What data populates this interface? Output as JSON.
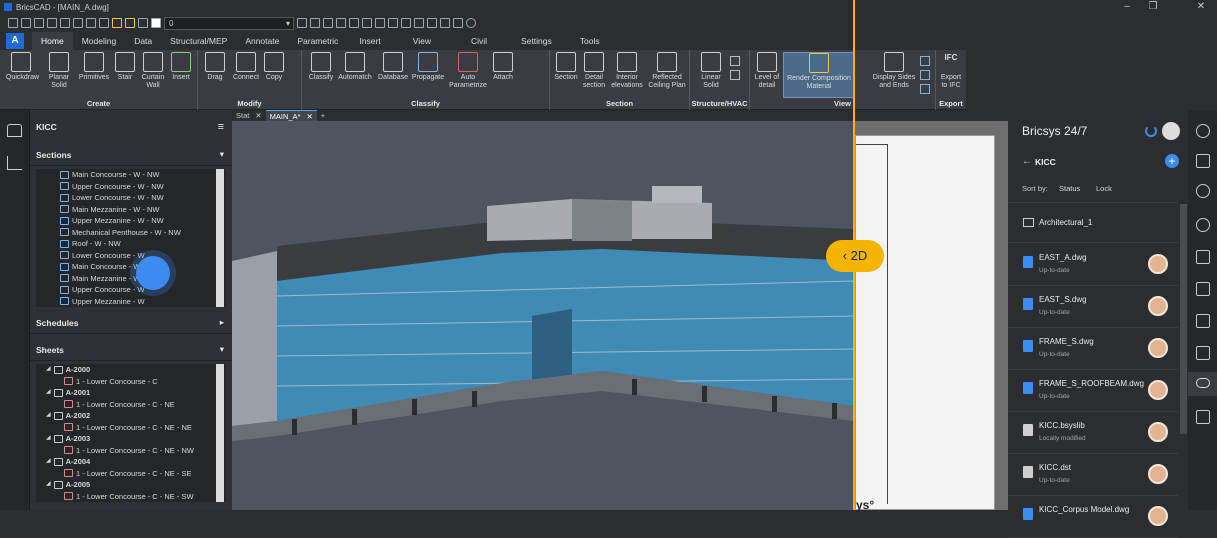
{
  "window": {
    "title": "BricsCAD - [MAIN_A.dwg]",
    "minimize": "–",
    "maximize": "❐",
    "close": "✕"
  },
  "qat": {
    "layer_value": "0"
  },
  "app_button": "A",
  "tabs": [
    "Home",
    "Modeling",
    "Data",
    "Structural/MEP",
    "Annotate",
    "Parametric",
    "Insert",
    "View",
    "Civil",
    "Settings",
    "Tools"
  ],
  "ribbon": {
    "groups": [
      {
        "title": "Create",
        "buttons": [
          "Quickdraw",
          "Planar\nSolid",
          "Primitives",
          "Stair",
          "Curtain\nWall",
          "Insert"
        ]
      },
      {
        "title": "Modify",
        "buttons": [
          "Drag",
          "Connect",
          "Copy"
        ]
      },
      {
        "title": "Classify",
        "buttons": [
          "Classify",
          "Automatch",
          "Database",
          "Propagate",
          "Auto\nParametrize",
          "Attach"
        ]
      },
      {
        "title": "Section",
        "buttons": [
          "Section",
          "Detail\nsection",
          "Interior\nelevations",
          "Reflected\nCeiling Plan"
        ]
      },
      {
        "title": "Structure/HVAC",
        "buttons": [
          "Linear\nSolid"
        ]
      },
      {
        "title": "View",
        "buttons": [
          "Level of\ndetail",
          "Render Composition\nMaterial",
          "Display Sides\nand Ends"
        ]
      },
      {
        "title": "Export",
        "buttons": [
          "Export\nto IFC"
        ]
      }
    ],
    "ifc_label": "IFC"
  },
  "doc_tabs": [
    {
      "label": "Stat",
      "close": "✕"
    },
    {
      "label": "MAIN_A*",
      "close": "✕"
    },
    {
      "label": "+",
      "close": ""
    }
  ],
  "left_panel": {
    "project": "KICC",
    "sections_title": "Sections",
    "sections": [
      "Main Concourse - W - NW",
      "Upper Concourse - W - NW",
      "Lower Concourse - W - NW",
      "Main Mezzanine - W - NW",
      "Upper Mezzanine - W - NW",
      "Mechanical Penthouse - W - NW",
      "Roof - W - NW",
      "Lower Concourse - W",
      "Main Concourse - W",
      "Main Mezzanine - W",
      "Upper Concourse - W",
      "Upper Mezzanine - W"
    ],
    "schedules_title": "Schedules",
    "sheets_title": "Sheets",
    "sheets": [
      {
        "name": "A-2000",
        "child": "1 - Lower Concourse - C"
      },
      {
        "name": "A-2001",
        "child": "1 - Lower Concourse - C - NE"
      },
      {
        "name": "A-2002",
        "child": "1 - Lower Concourse - C - NE - NE"
      },
      {
        "name": "A-2003",
        "child": "1 - Lower Concourse - C - NE - NW"
      },
      {
        "name": "A-2004",
        "child": "1 - Lower Concourse - C - NE - SE"
      },
      {
        "name": "A-2005",
        "child": "1 - Lower Concourse - C - NE - SW"
      }
    ]
  },
  "viewport": {
    "toggle_label": "2D",
    "paper_text": "ys°"
  },
  "right_panel": {
    "title": "Bricsys 24/7",
    "folder": "KICC",
    "sort_label": "Sort by:",
    "sort_status": "Status",
    "sort_lock": "Lock",
    "subfolder": "Architectural_1",
    "files": [
      {
        "name": "EAST_A.dwg",
        "status": "Up-to-date",
        "type": "dwg"
      },
      {
        "name": "EAST_S.dwg",
        "status": "Up-to-date",
        "type": "dwg"
      },
      {
        "name": "FRAME_S.dwg",
        "status": "Up-to-date",
        "type": "dwg"
      },
      {
        "name": "FRAME_S_ROOFBEAM.dwg",
        "status": "Up-to-date",
        "type": "dwg"
      },
      {
        "name": "KICC.bsyslib",
        "status": "Locally modified",
        "type": "doc"
      },
      {
        "name": "KICC.dst",
        "status": "Up-to-date",
        "type": "doc"
      },
      {
        "name": "KICC_Corpus Model.dwg",
        "status": "",
        "type": "dwg"
      }
    ]
  },
  "colors": {
    "accent": "#1e6bd6",
    "toggle": "#f5b400",
    "glass": "#3f8bb6",
    "panel": "#2f3136"
  }
}
